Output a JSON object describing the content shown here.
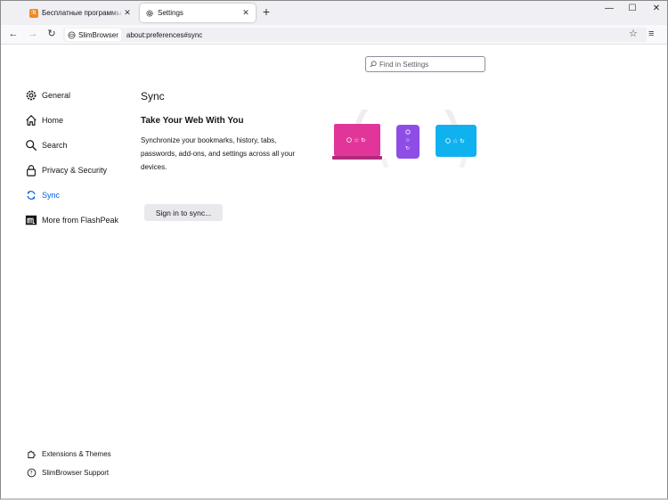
{
  "tabs": [
    {
      "title": "Бесплатные программы на FreeSoft",
      "icon": "rss-icon",
      "active": false
    },
    {
      "title": "Settings",
      "icon": "gear-icon",
      "active": true
    }
  ],
  "navbar": {
    "identity_label": "SlimBrowser",
    "url": "about:preferences#sync"
  },
  "search": {
    "placeholder": "Find in Settings"
  },
  "categories": [
    {
      "label": "General",
      "icon": "gear-icon"
    },
    {
      "label": "Home",
      "icon": "home-icon"
    },
    {
      "label": "Search",
      "icon": "search-icon"
    },
    {
      "label": "Privacy & Security",
      "icon": "lock-icon"
    },
    {
      "label": "Sync",
      "icon": "sync-icon",
      "selected": true
    },
    {
      "label": "More from FlashPeak",
      "icon": "flashpeak-logo-icon"
    }
  ],
  "sync": {
    "heading": "Sync",
    "subheading": "Take Your Web With You",
    "description": "Synchronize your bookmarks, history, tabs, passwords, add-ons, and settings across all your devices.",
    "button_label": "Sign in to sync..."
  },
  "footer": {
    "extensions_label": "Extensions & Themes",
    "support_label": "SlimBrowser Support"
  },
  "colors": {
    "accent": "#0061e0",
    "laptop": "#e2359a",
    "phone": "#8f4de8",
    "tablet": "#0fb2ef"
  }
}
